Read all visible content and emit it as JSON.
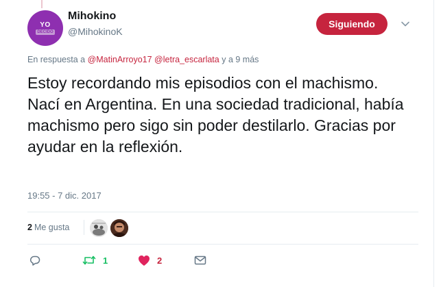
{
  "tweet": {
    "user": {
      "display_name": "Mihokino",
      "handle": "@MihokinoK",
      "avatar_text_main": "YO",
      "avatar_text_sub": "DECIDO"
    },
    "follow_button": {
      "label": "Siguiendo"
    },
    "reply_context": {
      "prefix": "En respuesta a",
      "mention_1": "@MatinArroyo17",
      "mention_2": "@letra_escarlata",
      "suffix": "y a 9 más"
    },
    "text": "Estoy recordando mis episodios con el machismo. Nací en Argentina. En una sociedad tradicional, había machismo pero sigo sin poder destilarlo. Gracias por ayudar en la reflexión.",
    "timestamp": "19:55 - 7 dic. 2017",
    "stats": {
      "likes_count": "2",
      "likes_label": "Me gusta"
    },
    "actions": {
      "retweet_count": "1",
      "like_count": "2"
    }
  },
  "colors": {
    "accent": "#c6243e",
    "retweet_green": "#17bf63",
    "muted_text": "#657786",
    "avatar_purple": "#8e2fb0"
  },
  "icons": [
    "chevron-down-icon",
    "reply-icon",
    "retweet-icon",
    "heart-icon",
    "envelope-icon"
  ]
}
